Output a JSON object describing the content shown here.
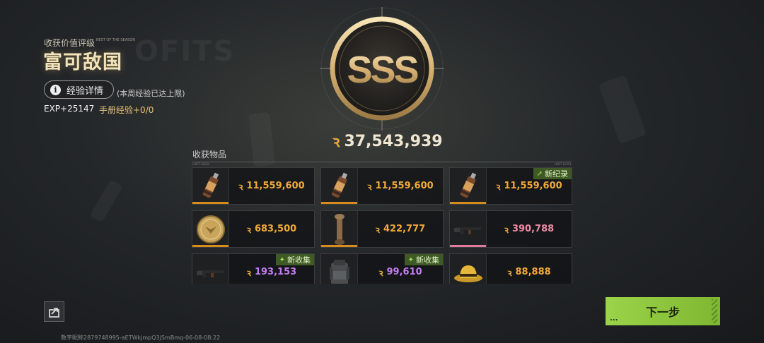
{
  "header": {
    "grade_label": "收获价值评级",
    "grade_tag": "BEST OF THE SEASON",
    "grade_title": "富可敌国",
    "exp_details_button": "经验详情",
    "info_glyph": "i",
    "weekly_note": "(本周经验已达上限)",
    "exp_value": "EXP+25147",
    "manual_exp": "手册经验+0/0"
  },
  "medal": {
    "rank": "SSS",
    "total_value": "37,543,939"
  },
  "currency_glyph": "ꝛ",
  "items": {
    "label": "收获物品",
    "cards": [
      {
        "name": "item-spray-can",
        "value": "11,559,600",
        "quality": "gold",
        "icon": "spray-can-icon",
        "badge": ""
      },
      {
        "name": "item-spray-can",
        "value": "11,559,600",
        "quality": "gold",
        "icon": "spray-can-icon",
        "badge": ""
      },
      {
        "name": "item-spray-can",
        "value": "11,559,600",
        "quality": "gold",
        "icon": "spray-can-icon",
        "badge": "新纪录"
      },
      {
        "name": "item-gold-coin",
        "value": "683,500",
        "quality": "gold",
        "icon": "gold-coin-icon",
        "badge": ""
      },
      {
        "name": "item-leg-bone",
        "value": "422,777",
        "quality": "gold",
        "icon": "bone-icon",
        "badge": ""
      },
      {
        "name": "item-rifle",
        "value": "390,788",
        "quality": "pink",
        "icon": "rifle-icon",
        "badge": ""
      },
      {
        "name": "item-rifle",
        "value": "193,153",
        "quality": "purple",
        "icon": "rifle-icon",
        "badge": "新收集"
      },
      {
        "name": "item-backpack",
        "value": "99,610",
        "quality": "purple",
        "icon": "backpack-icon",
        "badge": "新收集"
      },
      {
        "name": "item-hat",
        "value": "88,888",
        "quality": "gold",
        "icon": "hat-icon",
        "badge": ""
      }
    ]
  },
  "next_button": "下一步",
  "footer_id": "数字昵称2879748995-aETWkjmpQ3jSmBmq-06-08-08:22",
  "colors": {
    "gold_value": "#f0a93b",
    "pink_value": "#f08aa6",
    "purple_value": "#c57cf2",
    "next_button": "#9bd34a"
  }
}
